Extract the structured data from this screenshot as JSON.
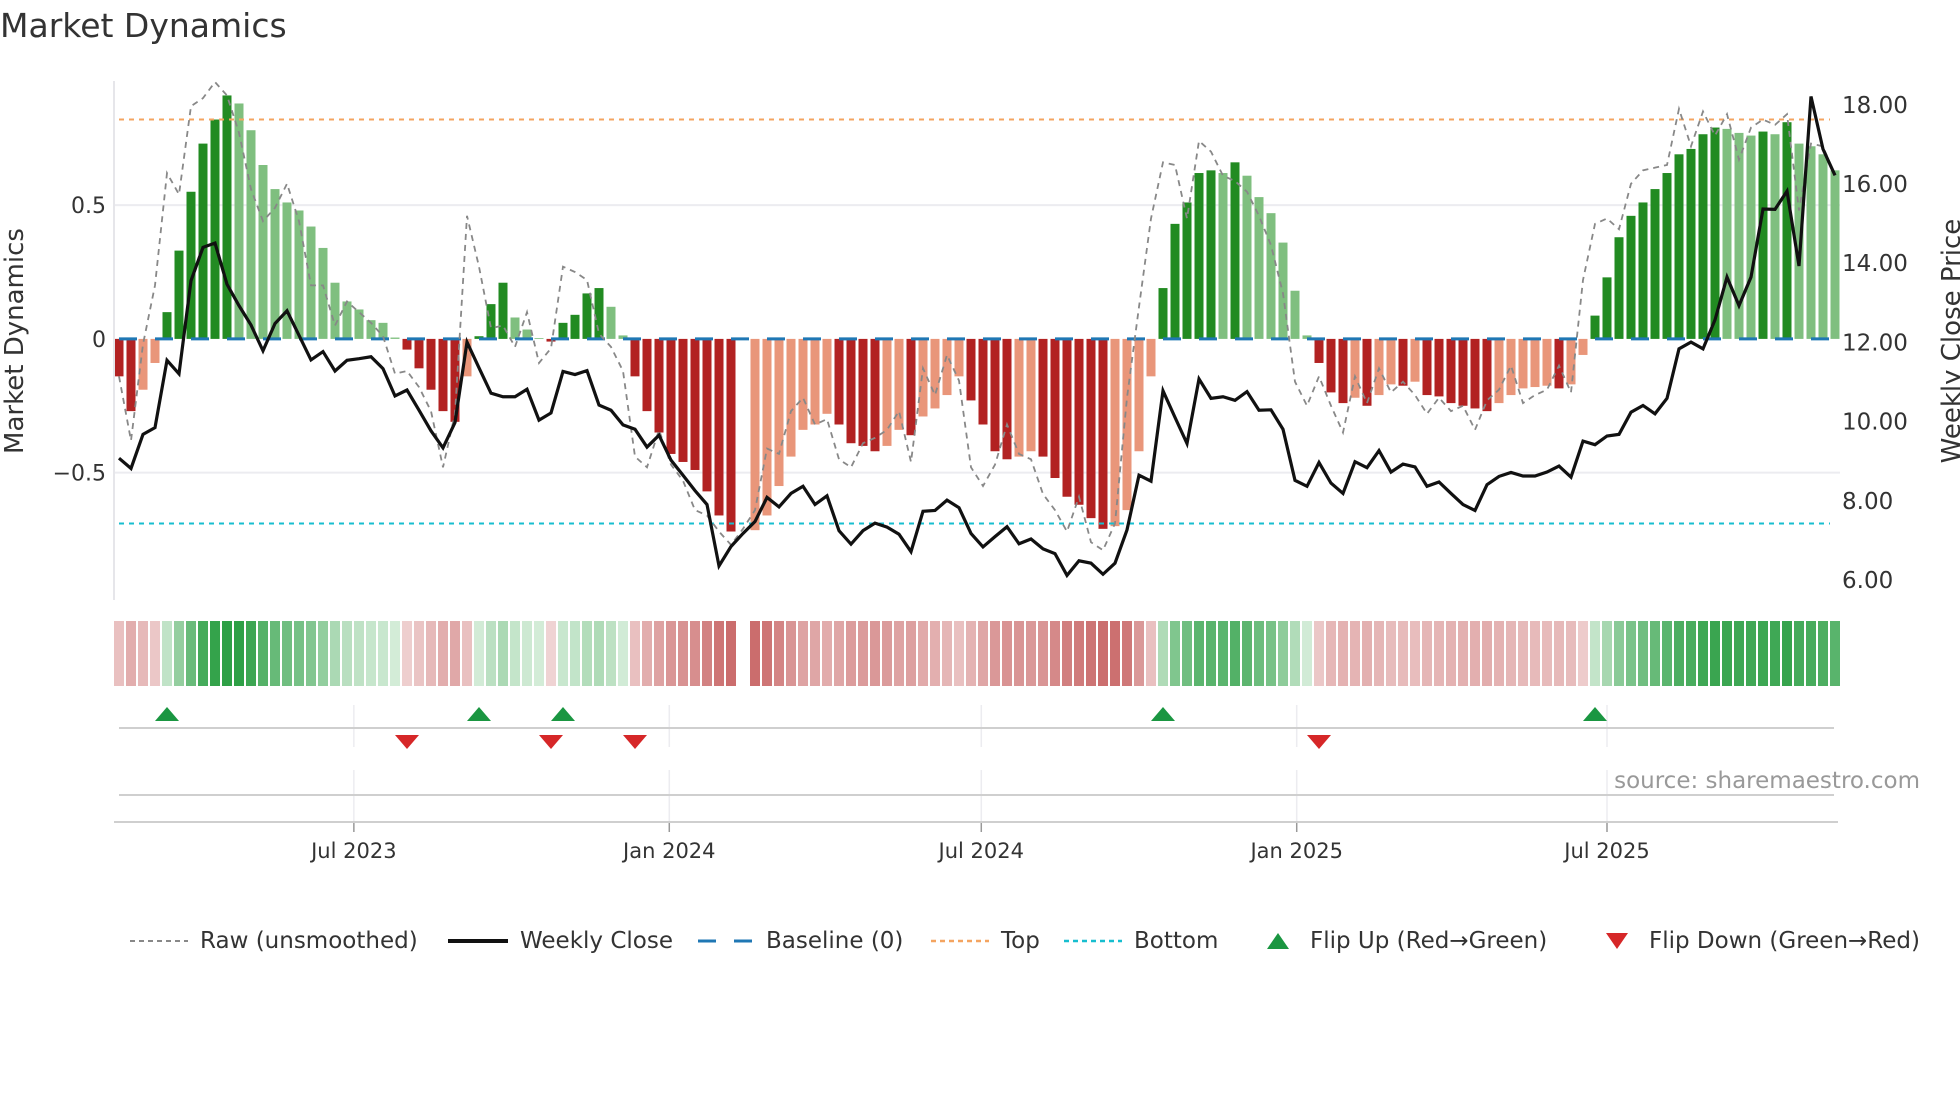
{
  "title": "Market Dynamics",
  "source": "source: sharemaestro.com",
  "chart_data": {
    "type": "bar",
    "title": "Market Dynamics",
    "ylabel": "Market Dynamics",
    "ylabel_right": "Weekly Close Price",
    "start_week": "2023-02-14",
    "interval_days": 7,
    "ylim": [
      -0.976,
      0.964
    ],
    "ylim_right": [
      5.5,
      18.6
    ],
    "top_level": 0.82,
    "bottom_level": -0.69,
    "baseline": 0,
    "yticks": [
      {
        "v": 0.5,
        "label": "0.5"
      },
      {
        "v": 0,
        "label": "0"
      },
      {
        "v": -0.5,
        "label": "−0.5"
      }
    ],
    "yticks_right": [
      {
        "v": 18,
        "label": "18.00"
      },
      {
        "v": 16,
        "label": "16.00"
      },
      {
        "v": 14,
        "label": "14.00"
      },
      {
        "v": 12,
        "label": "12.00"
      },
      {
        "v": 10,
        "label": "10.00"
      },
      {
        "v": 8,
        "label": "8.00"
      },
      {
        "v": 6,
        "label": "6.00"
      }
    ],
    "xticks": [
      {
        "date": "2023-07-01",
        "label": "Jul 2023"
      },
      {
        "date": "2024-01-01",
        "label": "Jan 2024"
      },
      {
        "date": "2024-07-01",
        "label": "Jul 2024"
      },
      {
        "date": "2025-01-01",
        "label": "Jan 2025"
      },
      {
        "date": "2025-07-01",
        "label": "Jul 2025"
      }
    ],
    "dynamics": [
      -0.14,
      -0.27,
      -0.19,
      -0.09,
      0.1,
      0.33,
      0.55,
      0.73,
      0.82,
      0.91,
      0.88,
      0.78,
      0.65,
      0.56,
      0.51,
      0.48,
      0.42,
      0.34,
      0.21,
      0.14,
      0.11,
      0.07,
      0.06,
      0.005,
      -0.04,
      -0.11,
      -0.19,
      -0.27,
      -0.31,
      -0.14,
      0.01,
      0.13,
      0.21,
      0.08,
      0.035,
      0.003,
      -0.01,
      0.06,
      0.09,
      0.17,
      0.19,
      0.12,
      0.013,
      -0.14,
      -0.27,
      -0.35,
      -0.43,
      -0.46,
      -0.49,
      -0.57,
      -0.66,
      -0.72,
      null,
      -0.715,
      -0.66,
      -0.55,
      -0.44,
      -0.34,
      -0.32,
      -0.28,
      -0.32,
      -0.39,
      -0.4,
      -0.42,
      -0.4,
      -0.34,
      -0.36,
      -0.29,
      -0.26,
      -0.21,
      -0.14,
      -0.23,
      -0.32,
      -0.42,
      -0.45,
      -0.44,
      -0.42,
      -0.44,
      -0.52,
      -0.59,
      -0.62,
      -0.67,
      -0.71,
      -0.7,
      -0.64,
      -0.42,
      -0.14,
      0.19,
      0.43,
      0.51,
      0.62,
      0.63,
      0.62,
      0.66,
      0.61,
      0.53,
      0.47,
      0.36,
      0.18,
      0.013,
      -0.09,
      -0.2,
      -0.24,
      -0.22,
      -0.25,
      -0.21,
      -0.17,
      -0.175,
      -0.16,
      -0.21,
      -0.215,
      -0.24,
      -0.25,
      -0.26,
      -0.27,
      -0.24,
      -0.21,
      -0.185,
      -0.18,
      -0.175,
      -0.185,
      -0.17,
      -0.06,
      0.087,
      0.23,
      0.38,
      0.46,
      0.51,
      0.56,
      0.62,
      0.69,
      0.71,
      0.765,
      0.79,
      0.785,
      0.77,
      0.76,
      0.775,
      0.765,
      0.81,
      0.73,
      0.72,
      0.69,
      0.63
    ],
    "raw": [
      -0.14,
      -0.38,
      -0.02,
      0.2,
      0.62,
      0.54,
      0.87,
      0.9,
      0.96,
      0.91,
      0.77,
      0.56,
      0.44,
      0.49,
      0.58,
      0.44,
      0.2,
      0.2,
      0.05,
      0.14,
      0.1,
      0.06,
      0.01,
      -0.13,
      -0.12,
      -0.18,
      -0.27,
      -0.48,
      -0.28,
      0.46,
      0.27,
      0.04,
      0.05,
      -0.03,
      0.1,
      -0.09,
      -0.035,
      0.27,
      0.25,
      0.22,
      0.02,
      -0.03,
      -0.12,
      -0.44,
      -0.48,
      -0.34,
      -0.47,
      -0.53,
      -0.64,
      -0.66,
      -0.72,
      -0.77,
      -0.71,
      -0.64,
      -0.41,
      -0.43,
      -0.27,
      -0.22,
      -0.32,
      -0.3,
      -0.45,
      -0.48,
      -0.39,
      -0.37,
      -0.34,
      -0.27,
      -0.46,
      -0.11,
      -0.21,
      -0.06,
      -0.156,
      -0.48,
      -0.55,
      -0.47,
      -0.32,
      -0.43,
      -0.45,
      -0.58,
      -0.64,
      -0.72,
      -0.59,
      -0.76,
      -0.79,
      -0.69,
      -0.22,
      0.12,
      0.45,
      0.66,
      0.65,
      0.45,
      0.74,
      0.7,
      0.61,
      0.59,
      0.55,
      0.46,
      0.35,
      0.17,
      -0.16,
      -0.25,
      -0.14,
      -0.25,
      -0.35,
      -0.14,
      -0.24,
      -0.11,
      -0.2,
      -0.16,
      -0.21,
      -0.28,
      -0.22,
      -0.27,
      -0.25,
      -0.34,
      -0.23,
      -0.19,
      -0.1,
      -0.24,
      -0.21,
      -0.19,
      -0.1,
      -0.2,
      0.22,
      0.43,
      0.45,
      0.41,
      0.58,
      0.63,
      0.64,
      0.65,
      0.86,
      0.72,
      0.85,
      0.76,
      0.84,
      0.67,
      0.79,
      0.82,
      0.8,
      0.84,
      0.48,
      0.73,
      0.72,
      0.61
    ],
    "close": [
      9.08,
      8.82,
      9.68,
      9.85,
      11.55,
      11.21,
      13.56,
      14.4,
      14.51,
      13.47,
      12.93,
      12.44,
      11.79,
      12.48,
      12.8,
      12.18,
      11.56,
      11.77,
      11.28,
      11.55,
      11.59,
      11.64,
      11.34,
      10.65,
      10.8,
      10.29,
      9.77,
      9.34,
      9.98,
      12.01,
      11.36,
      10.72,
      10.63,
      10.63,
      10.82,
      10.04,
      10.22,
      11.27,
      11.19,
      11.29,
      10.42,
      10.29,
      9.92,
      9.81,
      9.36,
      9.66,
      9.03,
      8.65,
      8.26,
      7.91,
      6.36,
      6.85,
      7.18,
      7.48,
      8.09,
      7.85,
      8.19,
      8.37,
      7.91,
      8.13,
      7.25,
      6.91,
      7.25,
      7.44,
      7.34,
      7.16,
      6.72,
      7.74,
      7.76,
      8.02,
      7.83,
      7.18,
      6.84,
      7.1,
      7.35,
      6.92,
      7.04,
      6.79,
      6.67,
      6.12,
      6.49,
      6.43,
      6.15,
      6.43,
      7.27,
      8.65,
      8.5,
      10.78,
      10.11,
      9.45,
      11.08,
      10.59,
      10.63,
      10.54,
      10.76,
      10.29,
      10.3,
      9.81,
      8.52,
      8.37,
      8.97,
      8.45,
      8.19,
      8.99,
      8.84,
      9.27,
      8.73,
      8.93,
      8.86,
      8.37,
      8.48,
      8.19,
      7.91,
      7.76,
      8.41,
      8.62,
      8.72,
      8.63,
      8.63,
      8.73,
      8.88,
      8.6,
      9.51,
      9.42,
      9.64,
      9.68,
      10.24,
      10.41,
      10.2,
      10.59,
      11.84,
      12.01,
      11.84,
      12.57,
      13.65,
      12.93,
      13.65,
      15.37,
      15.36,
      15.82,
      13.93,
      18.21,
      16.88,
      16.22
    ],
    "flip_up_idx": [
      4,
      30,
      37,
      87,
      123
    ],
    "flip_down_idx": [
      24,
      36,
      43,
      100
    ],
    "legend": {
      "placement": "bottom",
      "raw": "Raw (unsmoothed)",
      "close": "Weekly Close",
      "baseline": "Baseline (0)",
      "top": "Top",
      "bottom": "Bottom",
      "flip_up": "Flip Up (Red→Green)",
      "flip_down": "Flip Down (Green→Red)"
    },
    "colors": {
      "pos_rising": "#228b22",
      "pos_falling": "#7fbf7f",
      "neg_falling": "#b22222",
      "neg_rising": "#e9967a",
      "raw": "#888888",
      "close": "#111111",
      "baseline": "#1f77b4",
      "top": "#f4a460",
      "bottom": "#17becf",
      "flip_up": "#1a9641",
      "flip_down": "#d62728"
    }
  }
}
